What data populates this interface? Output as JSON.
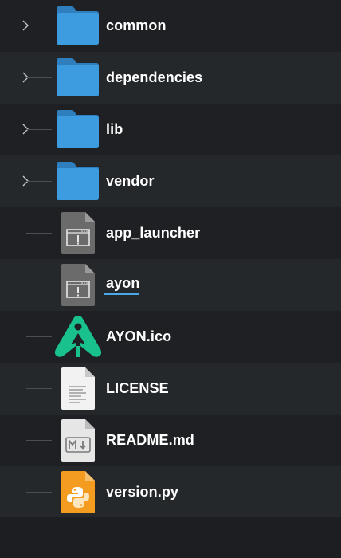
{
  "file_tree": {
    "items": [
      {
        "name": "common",
        "type": "folder",
        "icon": "folder-icon"
      },
      {
        "name": "dependencies",
        "type": "folder",
        "icon": "folder-icon"
      },
      {
        "name": "lib",
        "type": "folder",
        "icon": "folder-icon"
      },
      {
        "name": "vendor",
        "type": "folder",
        "icon": "folder-icon"
      },
      {
        "name": "app_launcher",
        "type": "file",
        "icon": "executable-icon"
      },
      {
        "name": "ayon",
        "type": "file",
        "icon": "executable-icon",
        "selected": true
      },
      {
        "name": "AYON.ico",
        "type": "file",
        "icon": "ayon-logo-icon"
      },
      {
        "name": "LICENSE",
        "type": "file",
        "icon": "text-document-icon"
      },
      {
        "name": "README.md",
        "type": "file",
        "icon": "markdown-icon"
      },
      {
        "name": "version.py",
        "type": "file",
        "icon": "python-icon"
      }
    ]
  },
  "colors": {
    "background": "#1c1e21",
    "row_alt": "#25282b",
    "folder_blue": "#3d9be0",
    "selection_underline": "#4aa8e8",
    "ayon_green": "#19c18c",
    "python_orange": "#f39c1f"
  }
}
